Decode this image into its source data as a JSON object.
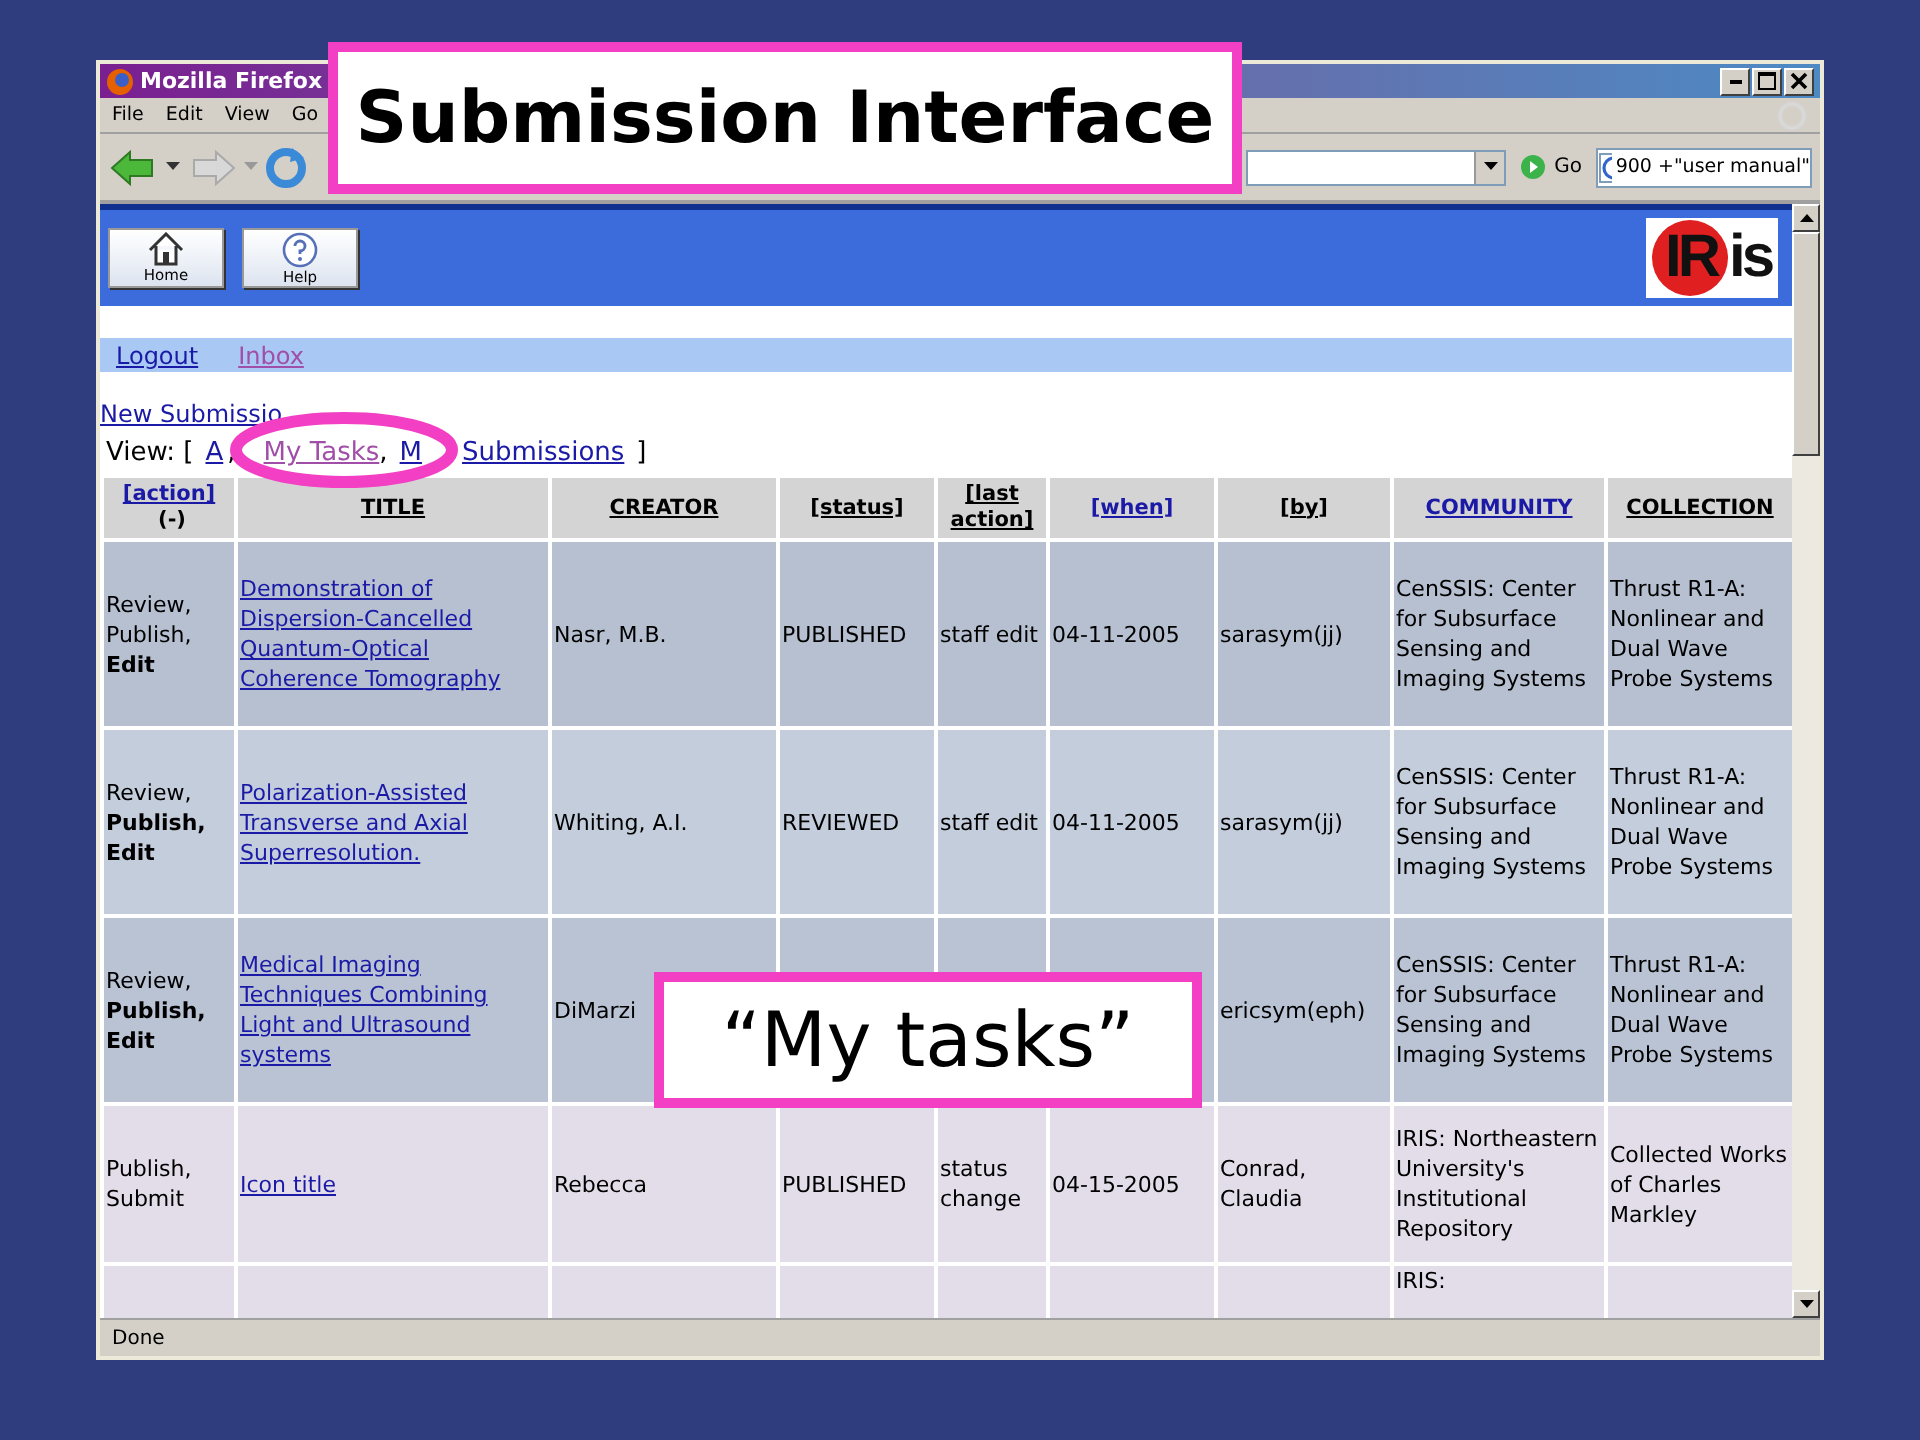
{
  "window": {
    "title": "Mozilla Firefox"
  },
  "menu": [
    "File",
    "Edit",
    "View",
    "Go"
  ],
  "toolbar": {
    "search_value": "900 +\"user manual\"",
    "go": "Go"
  },
  "banner": {
    "buttons": [
      {
        "label": "Home",
        "kind": "home"
      },
      {
        "label": "Help",
        "kind": "help"
      }
    ],
    "logo": {
      "circled": "IR",
      "rest": "is"
    }
  },
  "nav_links": [
    {
      "label": "Logout",
      "visited": false
    },
    {
      "label": "Inbox",
      "visited": true
    }
  ],
  "new_submission": "New Submissio",
  "view": {
    "label": "View: [",
    "links": [
      {
        "label": "A",
        "visited": false,
        "after": ","
      },
      {
        "label": "My Tasks",
        "visited": true,
        "after": ","
      },
      {
        "label": "M",
        "visited": false
      },
      {
        "label": "Submissions",
        "visited": false
      }
    ],
    "end": "]"
  },
  "table": {
    "columns": [
      {
        "label": "[action]",
        "link": true,
        "extra": "(-)"
      },
      {
        "label": "TITLE",
        "link": false
      },
      {
        "label": "CREATOR",
        "link": false
      },
      {
        "label": "[status]",
        "link": false
      },
      {
        "label": "[last action]",
        "link": false
      },
      {
        "label": "[when]",
        "link": true
      },
      {
        "label": "[by]",
        "link": false
      },
      {
        "label": "COMMUNITY",
        "link": true
      },
      {
        "label": "COLLECTION",
        "link": false
      }
    ],
    "rows": [
      {
        "color": "#b6c0d0",
        "actions": [
          "Review,",
          "Publish,",
          "**Edit**"
        ],
        "title": "Demonstration of Dispersion-Cancelled Quantum-Optical Coherence Tomography",
        "creator": "Nasr, M.B.",
        "status": "PUBLISHED",
        "last_action": "staff edit",
        "when": "04-11-2005",
        "by": "sarasym(jj)",
        "community": "CenSSIS: Center for Subsurface Sensing and Imaging Systems",
        "collection": "Thrust R1-A: Nonlinear and Dual Wave Probe Systems"
      },
      {
        "color": "#c4cddb",
        "actions": [
          "Review,",
          "**Publish,**",
          "**Edit**"
        ],
        "title": "Polarization-Assisted Transverse and Axial Superresolution.",
        "creator": "Whiting, A.I.",
        "status": "REVIEWED",
        "last_action": "staff edit",
        "when": "04-11-2005",
        "by": "sarasym(jj)",
        "community": "CenSSIS: Center for Subsurface Sensing and Imaging Systems",
        "collection": "Thrust R1-A: Nonlinear and Dual Wave Probe Systems"
      },
      {
        "color": "#b9c3d3",
        "actions": [
          "Review,",
          "**Publish,**",
          "**Edit**"
        ],
        "title": "Medical Imaging Techniques Combining Light and Ultrasound systems",
        "creator": "DiMarzi",
        "by": "ericsym(eph)",
        "community": "CenSSIS: Center for Subsurface Sensing and Imaging Systems",
        "collection": "Thrust R1-A: Nonlinear and Dual Wave Probe Systems"
      },
      {
        "color": "#e3dde9",
        "actions": [
          "Publish,",
          "Submit"
        ],
        "title": "Icon title",
        "creator": "Rebecca",
        "status": "PUBLISHED",
        "last_action": "status change",
        "when": "04-15-2005",
        "by": "Conrad, Claudia",
        "community": "IRIS: Northeastern University's Institutional Repository",
        "collection": "Collected Works of Charles Markley"
      },
      {
        "color": "#e3dde9",
        "community": "IRIS:"
      }
    ]
  },
  "status_bar": "Done",
  "callouts": [
    {
      "kind": "title",
      "text": "Submission Interface"
    },
    {
      "kind": "note",
      "text": "“My tasks”"
    }
  ]
}
